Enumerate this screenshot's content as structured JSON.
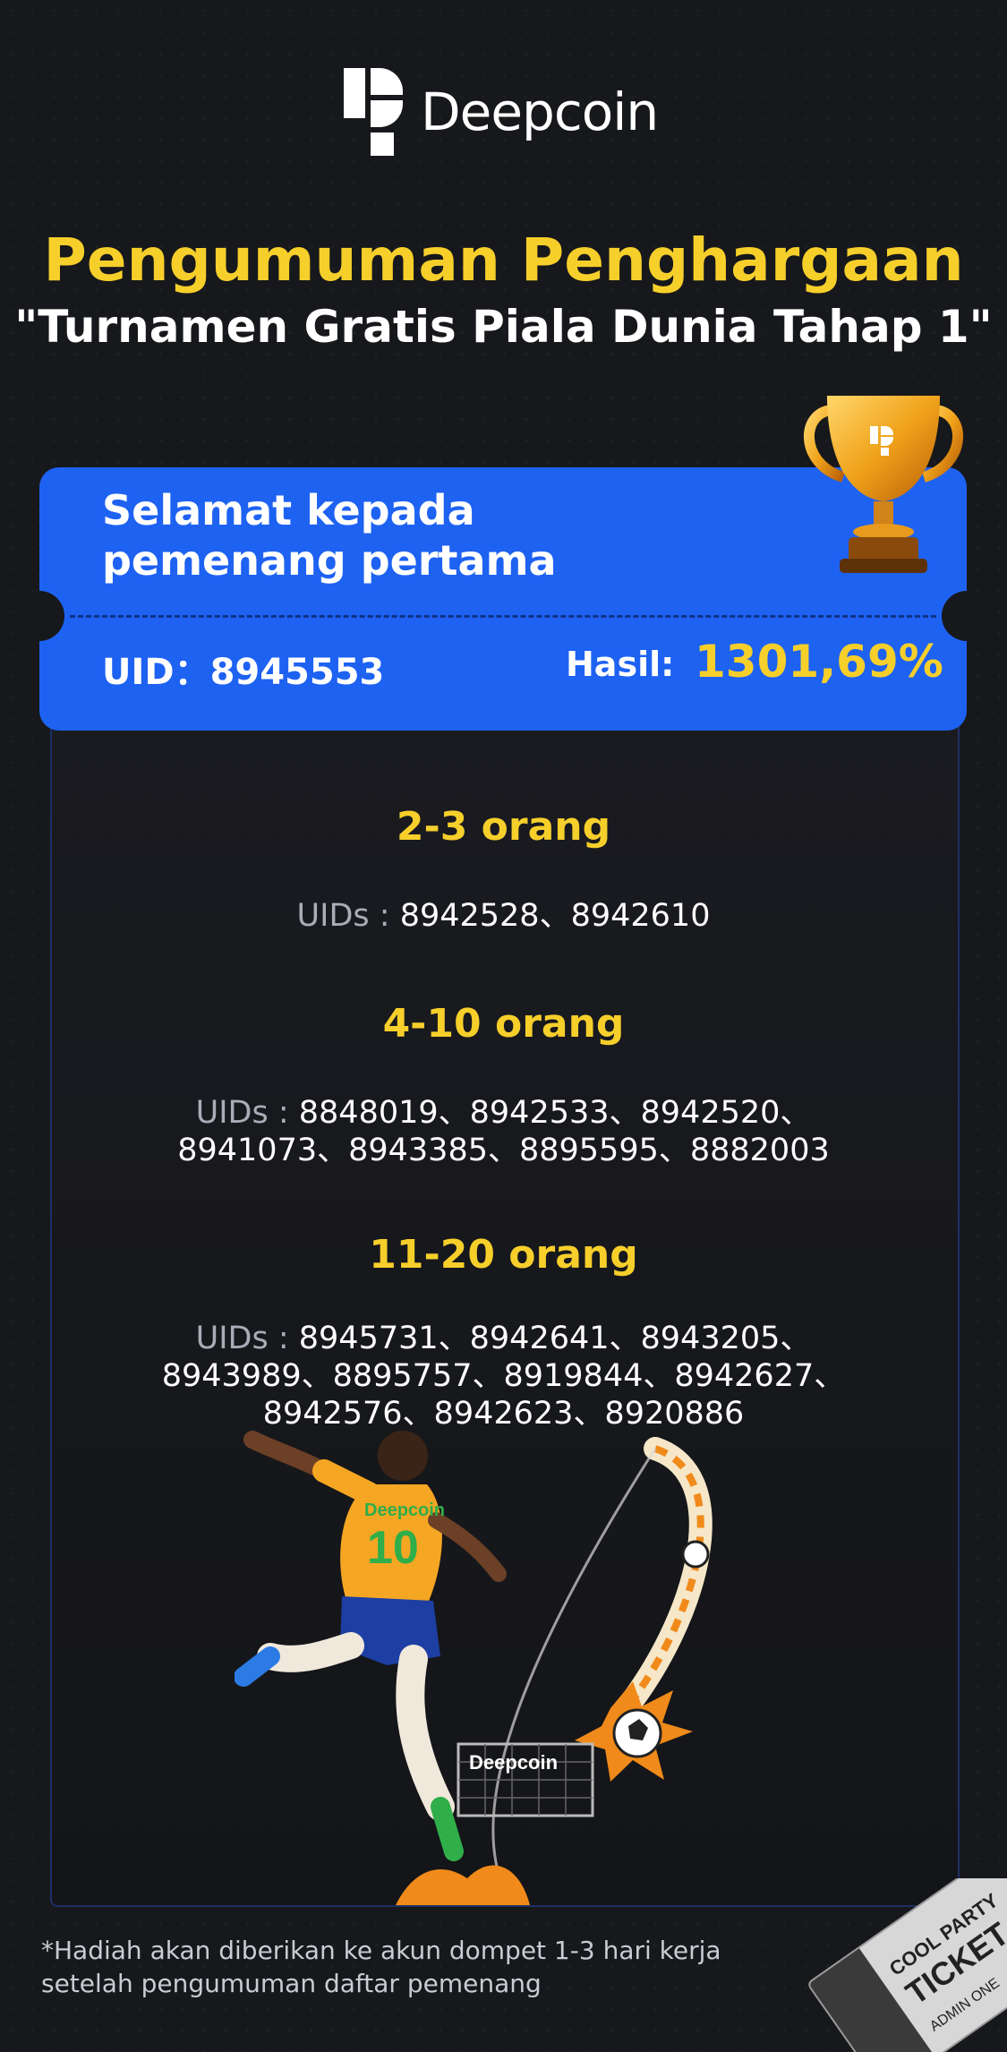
{
  "brand": {
    "name": "Deepcoin"
  },
  "header": {
    "title": "Pengumuman Penghargaan",
    "subtitle": "\"Turnamen Gratis Piala Dunia Tahap 1\""
  },
  "winner_card": {
    "heading": "Selamat kepada pemenang pertama",
    "uid_text": "UID：8945553",
    "result_label": "Hasil:",
    "result_value": "1301,69%"
  },
  "tiers": [
    {
      "title": "2-3 orang",
      "label": "UIDs :",
      "uids": "8942528、8942610"
    },
    {
      "title": "4-10 orang",
      "label": "UIDs :",
      "uids": "8848019、8942533、8942520、8941073、8943385、8895595、8882003"
    },
    {
      "title": "11-20 orang",
      "label": "UIDs :",
      "uids": "8945731、8942641、8943205、8943989、8895757、8919844、8942627、8942576、8942623、8920886"
    }
  ],
  "illustration": {
    "jersey_brand": "Deepcoin",
    "jersey_number": "10",
    "goal_brand": "Deepcoin"
  },
  "ticket_stub": {
    "line1": "COOL PARTY",
    "line2": "TICKET",
    "line3": "ADMIN ONE"
  },
  "footnote": "*Hadiah akan diberikan ke akun dompet 1-3 hari kerja setelah pengumuman daftar pemenang",
  "colors": {
    "accent_yellow": "#f7cf2b",
    "card_blue": "#1e62f2",
    "background": "#17181b"
  }
}
